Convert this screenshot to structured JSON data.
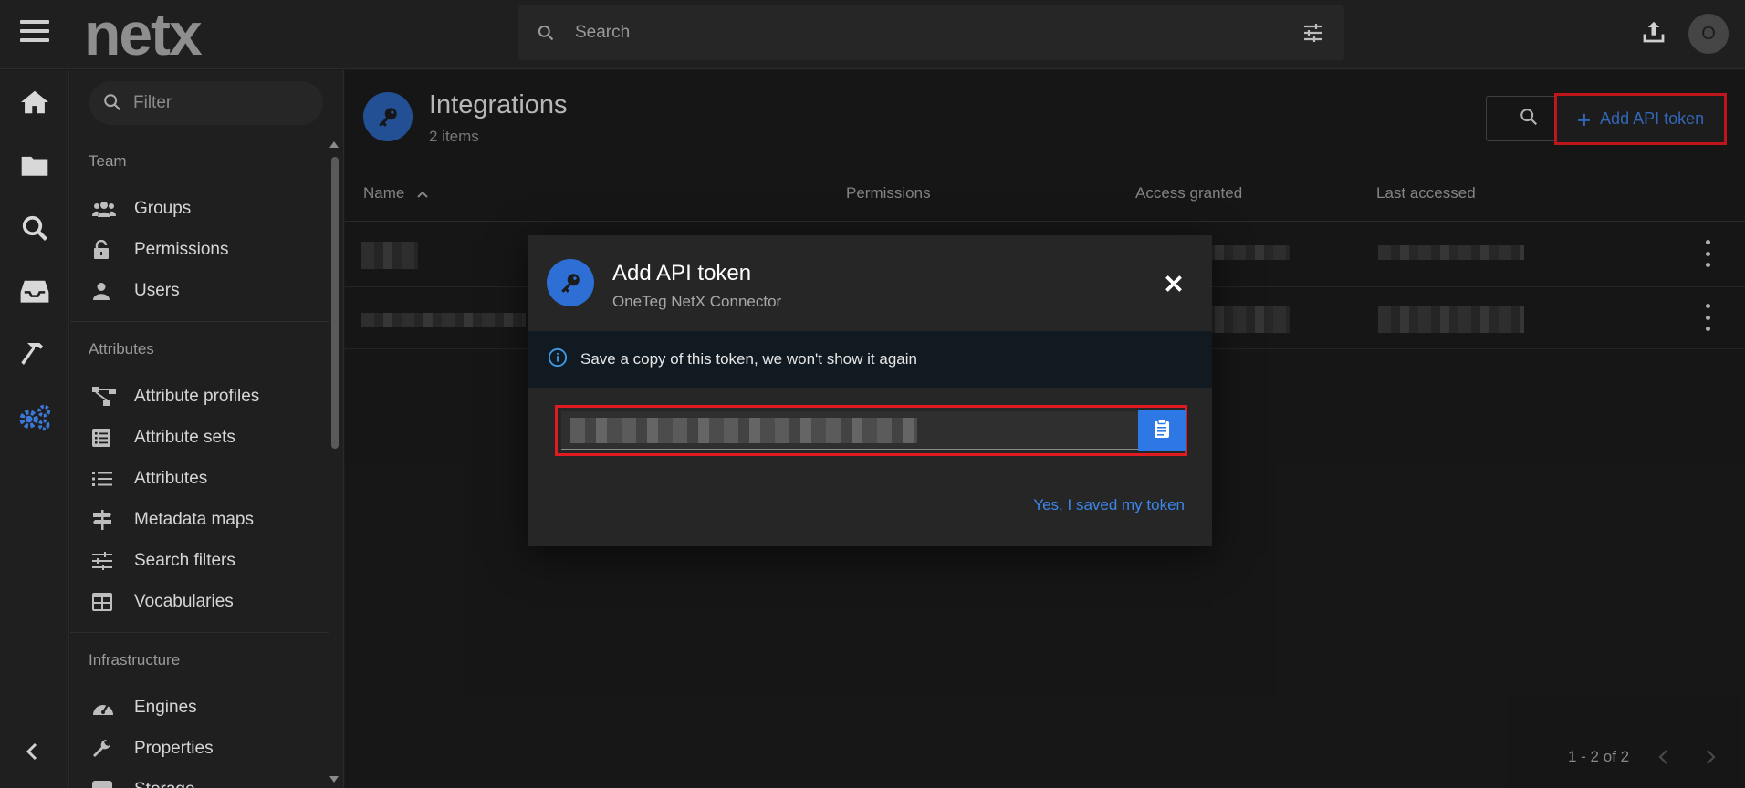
{
  "topbar": {
    "logo": "netx",
    "search_placeholder": "Search",
    "avatar_initial": "O"
  },
  "rail": {
    "items": [
      "home-icon",
      "folder-icon",
      "search-icon",
      "inbox-icon",
      "hammer-icon",
      "gears-icon"
    ],
    "active": "gears-icon"
  },
  "sidebar": {
    "filter_placeholder": "Filter",
    "sections": {
      "team": "Team",
      "attributes": "Attributes",
      "infrastructure": "Infrastructure"
    },
    "team_items": [
      "Groups",
      "Permissions",
      "Users"
    ],
    "attribute_items": [
      "Attribute profiles",
      "Attribute sets",
      "Attributes",
      "Metadata maps",
      "Search filters",
      "Vocabularies"
    ],
    "infra_items": [
      "Engines",
      "Properties",
      "Storage"
    ]
  },
  "main": {
    "title": "Integrations",
    "count": "2 items",
    "add_button": "Add API token",
    "columns": {
      "name": "Name",
      "permissions": "Permissions",
      "access_granted": "Access granted",
      "last_accessed": "Last accessed"
    },
    "pager": "1 - 2 of 2"
  },
  "dialog": {
    "title": "Add API token",
    "subtitle": "OneTeg NetX Connector",
    "info": "Save a copy of this token, we won't show it again",
    "confirm": "Yes, I saved my token"
  },
  "colors": {
    "accent": "#2e78e6",
    "highlight": "#e11b22",
    "background": "#1b1b1b"
  }
}
